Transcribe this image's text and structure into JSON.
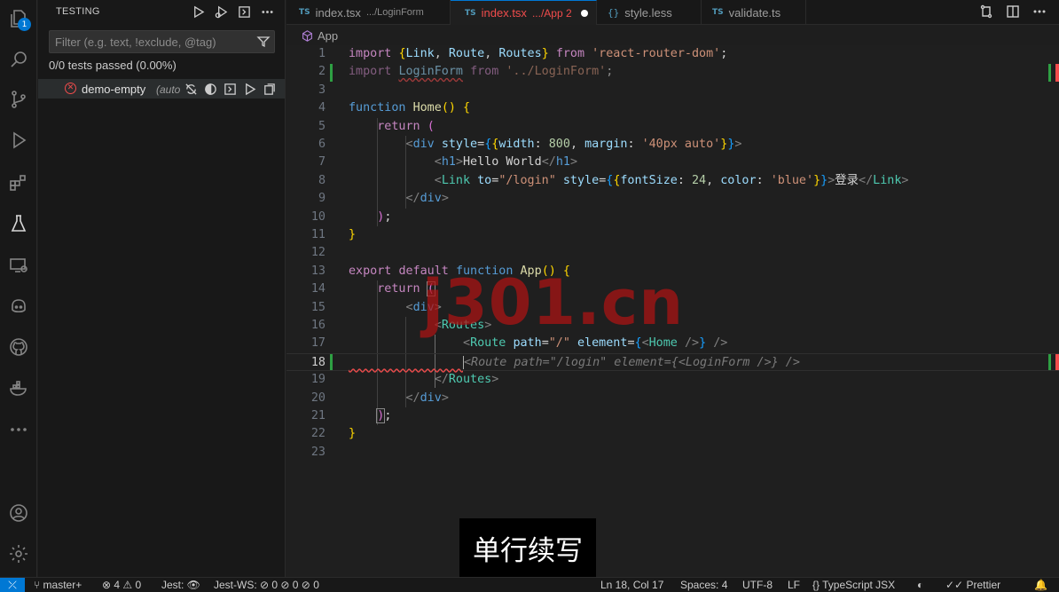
{
  "activity_bar": {
    "items": [
      "explorer-icon",
      "search-icon",
      "source-control-icon",
      "run-debug-icon",
      "extensions-icon",
      "testing-icon",
      "remote-explorer-icon",
      "copilot-icon",
      "github-icon",
      "docker-icon",
      "more-icon"
    ],
    "explorer_badge": "1",
    "bottom_items": [
      "account-icon",
      "settings-gear-icon"
    ]
  },
  "sidebar": {
    "title": "TESTING",
    "filter_placeholder": "Filter (e.g. text, !exclude, @tag)",
    "tests_passed": "0/0 tests passed (0.00%)",
    "test_item": {
      "name": "demo-empty",
      "badge": "(auto"
    }
  },
  "tabs": [
    {
      "lang": "TS",
      "name": "index.tsx",
      "desc": ".../LoginForm",
      "active": false
    },
    {
      "lang": "TS",
      "name": "index.tsx",
      "desc": ".../App 2",
      "active": true,
      "modified": true
    },
    {
      "lang": "{}",
      "name": "style.less",
      "desc": "",
      "active": false
    },
    {
      "lang": "TS",
      "name": "validate.ts",
      "desc": "",
      "active": false
    }
  ],
  "breadcrumb": "App",
  "editor": {
    "current_line": 18,
    "line_numbers": [
      "1",
      "2",
      "3",
      "4",
      "5",
      "6",
      "7",
      "8",
      "9",
      "10",
      "11",
      "12",
      "13",
      "14",
      "15",
      "16",
      "17",
      "18",
      "19",
      "20",
      "21",
      "22",
      "23"
    ]
  },
  "overlay": {
    "watermark": "j301.cn",
    "subtitle": "单行续写"
  },
  "status_bar": {
    "branch": "master+",
    "errors": "4",
    "warnings": "0",
    "jest": "Jest:",
    "jest_ws": "Jest-WS:",
    "jest_ws_counts": "0 0 0 0",
    "position": "Ln 18, Col 17",
    "spaces": "Spaces: 4",
    "encoding": "UTF-8",
    "eol": "LF",
    "language": "TypeScript JSX",
    "formatter": "Prettier"
  },
  "colors": {
    "accent": "#0078d4",
    "error": "#f14c4c",
    "added": "#2ea043"
  }
}
